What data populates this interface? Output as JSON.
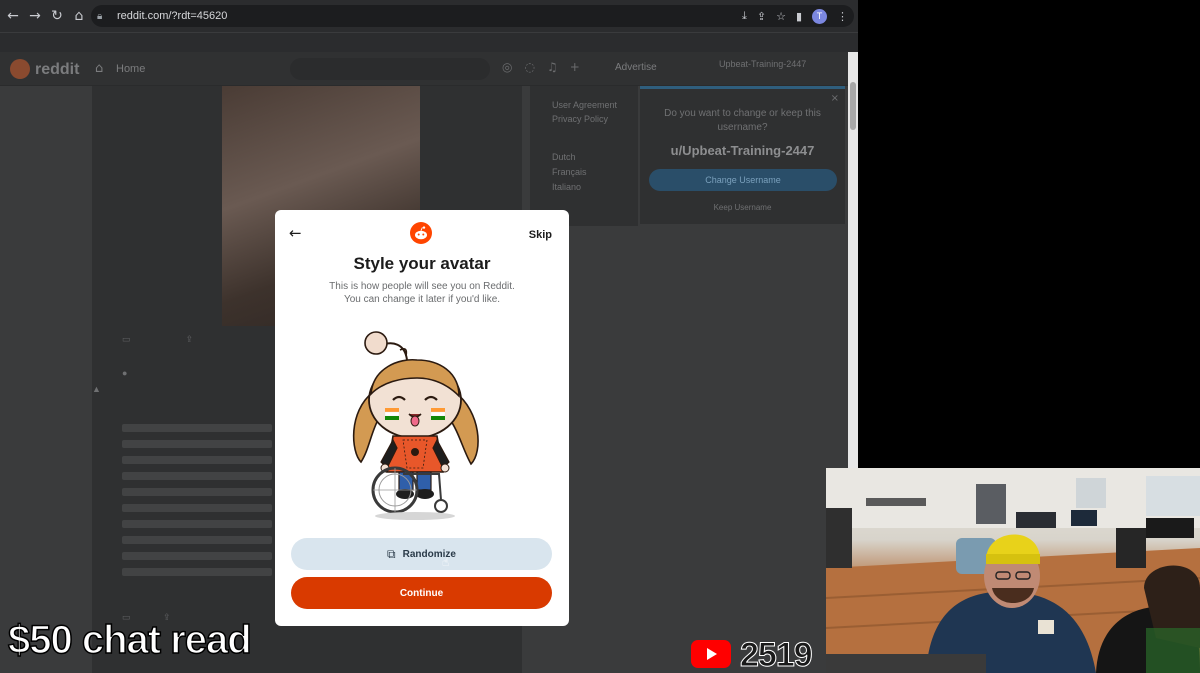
{
  "browser": {
    "url": "reddit.com/?rdt=45620",
    "profile_initial": "T"
  },
  "reddit": {
    "wordmark": "reddit",
    "home_label": "Home",
    "advertise_label": "Advertise",
    "user_chip_name": "Upbeat-Training-2447",
    "sidebar_links": [
      "User Agreement",
      "Privacy Policy",
      "Dutch",
      "Français",
      "Italiano"
    ],
    "username_prompt": {
      "question": "Do you want to change or keep this username?",
      "username": "u/Upbeat-Training-2447",
      "change_button": "Change Username",
      "keep_link": "Keep Username"
    }
  },
  "modal": {
    "title": "Style your avatar",
    "subtitle_line1": "This is how people will see you on Reddit.",
    "subtitle_line2": "You can change it later if you'd like.",
    "skip_label": "Skip",
    "randomize_label": "Randomize",
    "continue_label": "Continue"
  },
  "overlay": {
    "chat_read": "$50 chat read",
    "viewer_count": "2519"
  },
  "colors": {
    "reddit_orange": "#ff4500",
    "continue_button": "#d93a00",
    "randomize_button": "#d9e5ee",
    "youtube_red": "#ff0000"
  },
  "icons": {
    "back": "arrow-left-icon",
    "forward": "arrow-right-icon",
    "reload": "reload-icon",
    "home": "home-icon",
    "lock": "lock-icon",
    "randomize": "shuffle-icon",
    "modal_back": "arrow-left-icon"
  }
}
